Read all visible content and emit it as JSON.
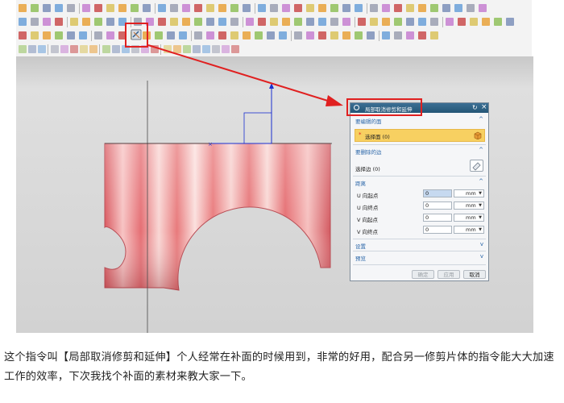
{
  "colors": {
    "accent_red": "#e02020",
    "surface": "#f0a0a0",
    "title_bar": "#2f6386",
    "section_blue": "#2a66a8",
    "select_yellow": "#f7d061"
  },
  "toolbar": {
    "icons": [
      "open-icon",
      "save-icon",
      "sketch-icon",
      "dimension-icon",
      "extrude-icon",
      "revolve-icon",
      "hole-icon",
      "blend-icon",
      "chamfer-icon",
      "shell-icon",
      "trim-body-icon",
      "untrim-extend-icon",
      "offset-icon",
      "scale-icon",
      "pattern-icon",
      "mirror-icon",
      "snap-icon",
      "view-icon"
    ],
    "highlighted_icon": "local-untrim-extend-icon"
  },
  "dialog": {
    "title": "局部取消修剪和延伸",
    "sections": {
      "faces": {
        "label": "要编辑的面",
        "select_label": "选择面 (0)"
      },
      "edges": {
        "label": "要删除的边",
        "select_label": "选择边 (0)"
      },
      "distance": {
        "label": "距离",
        "rows": [
          {
            "label": "U 向起点",
            "value": "0",
            "unit": "mm"
          },
          {
            "label": "U 向终点",
            "value": "0",
            "unit": "mm"
          },
          {
            "label": "V 向起点",
            "value": "0",
            "unit": "mm"
          },
          {
            "label": "V 向终点",
            "value": "0",
            "unit": "mm"
          }
        ]
      },
      "settings": {
        "label": "设置"
      },
      "preview": {
        "label": "预览"
      }
    },
    "buttons": {
      "ok": "确定",
      "apply": "应用",
      "cancel": "取消"
    }
  },
  "caption": "这个指令叫【局部取消修剪和延伸】个人经常在补面的时候用到，非常的好用，配合另一修剪片体的指令能大大加速工作的效率，下次我找个补面的素材来教大家一下。"
}
